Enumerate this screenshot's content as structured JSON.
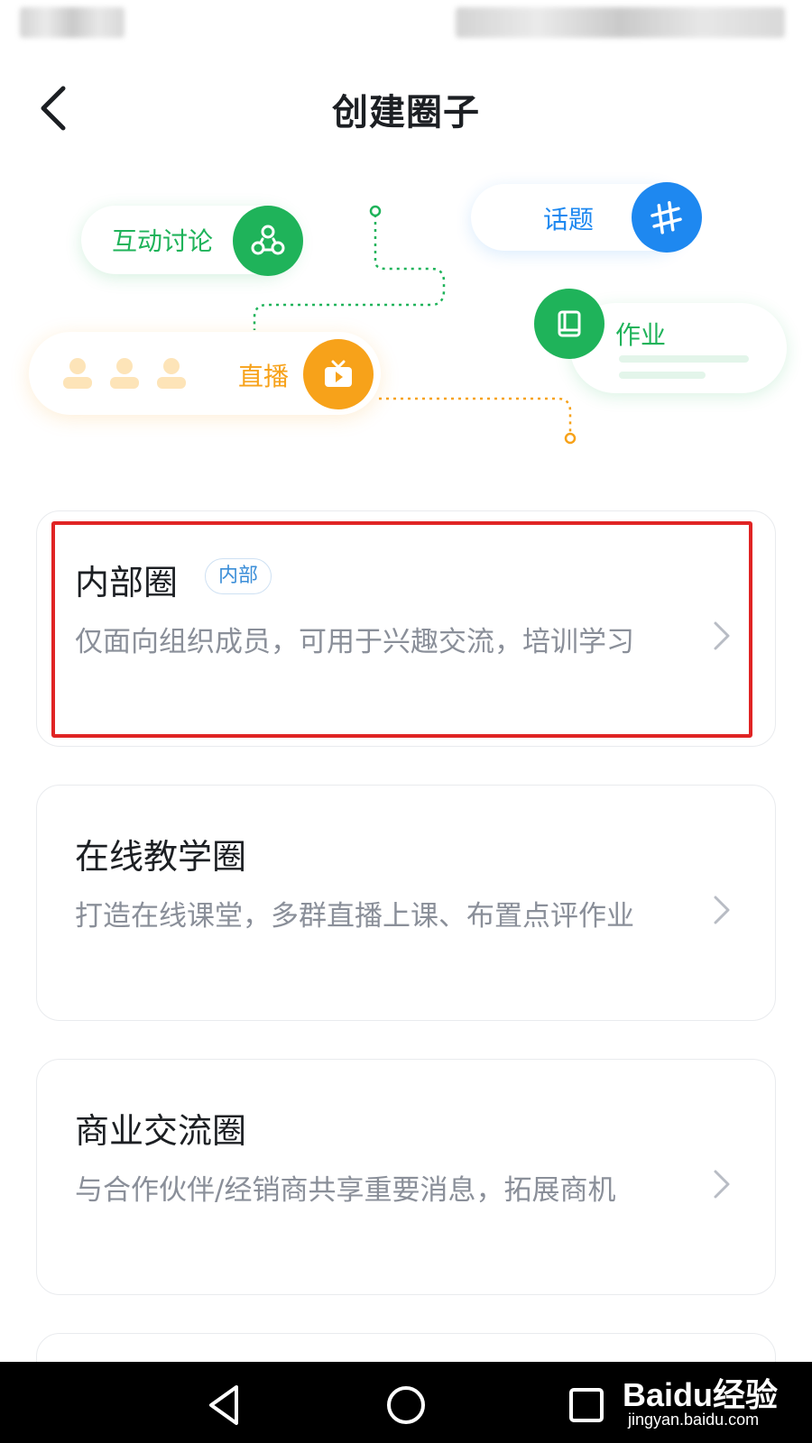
{
  "header": {
    "title": "创建圈子"
  },
  "hero": {
    "discussion_label": "互动讨论",
    "topic_label": "话题",
    "homework_label": "作业",
    "live_label": "直播",
    "colors": {
      "green": "#1fb35a",
      "blue": "#1e88f0",
      "orange": "#f7a21a"
    }
  },
  "cards": [
    {
      "title": "内部圈",
      "badge": "内部",
      "desc": "仅面向组织成员，可用于兴趣交流，培训学习"
    },
    {
      "title": "在线教学圈",
      "desc": "打造在线课堂，多群直播上课、布置点评作业"
    },
    {
      "title": "商业交流圈",
      "desc": "与合作伙伴/经销商共享重要消息，拓展商机"
    }
  ],
  "watermark": {
    "main": "Baidu经验",
    "sub": "jingyan.baidu.com"
  }
}
